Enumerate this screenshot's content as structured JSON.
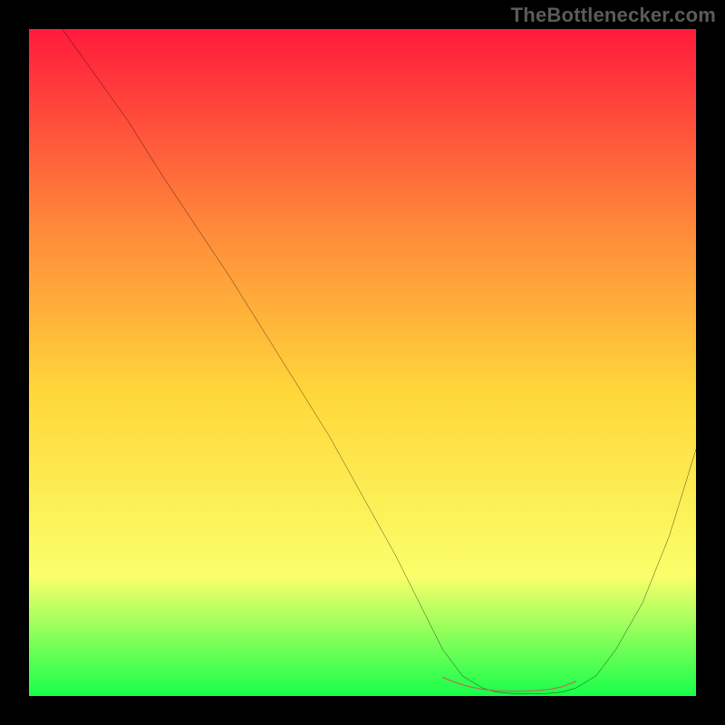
{
  "watermark": "TheBottlenecker.com",
  "colors": {
    "frame_bg": "#000000",
    "line": "#000000",
    "highlight": "#cf5a5e",
    "grad_top": "#ff1a3c",
    "grad_mid_upper": "#ff8a3a",
    "grad_mid": "#ffd83a",
    "grad_lower": "#faff6a",
    "grad_bottom": "#17ff4a"
  },
  "chart_data": {
    "type": "line",
    "title": "",
    "xlabel": "",
    "ylabel": "",
    "xlim": [
      0,
      100
    ],
    "ylim": [
      0,
      100
    ],
    "grid": false,
    "legend": null,
    "series": [
      {
        "name": "curve",
        "x": [
          5,
          10,
          15,
          20,
          25,
          30,
          35,
          40,
          45,
          50,
          55,
          60,
          62,
          65,
          68,
          70,
          72,
          75,
          78,
          80,
          82,
          85,
          88,
          92,
          96,
          100
        ],
        "y": [
          100,
          93,
          86,
          78,
          70.5,
          63,
          55,
          47,
          39,
          30,
          21,
          11,
          7,
          3,
          1.2,
          0.6,
          0.4,
          0.3,
          0.4,
          0.6,
          1.2,
          3,
          7,
          14,
          24,
          37
        ]
      },
      {
        "name": "near-minimum-highlight",
        "x": [
          62,
          64,
          66,
          68,
          70,
          72,
          74,
          76,
          78,
          80,
          82
        ],
        "y": [
          2.8,
          2.0,
          1.4,
          1.0,
          0.8,
          0.7,
          0.7,
          0.8,
          1.0,
          1.4,
          2.2
        ]
      }
    ],
    "annotations": []
  }
}
